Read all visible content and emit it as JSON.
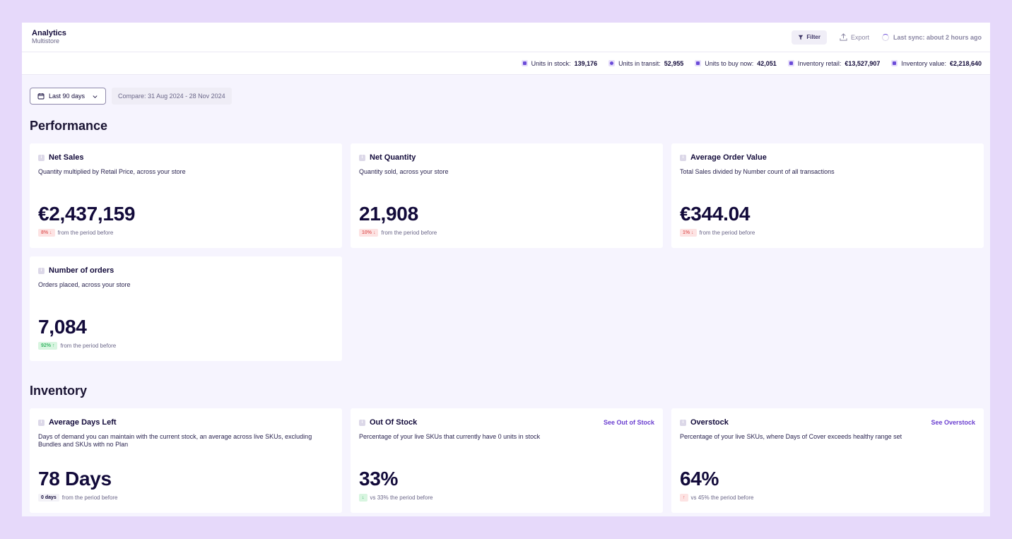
{
  "header": {
    "title": "Analytics",
    "subtitle": "Multistore",
    "filter_label": "Filter",
    "export_label": "Export",
    "sync_label": "Last sync: about 2 hours ago"
  },
  "stats": [
    {
      "label": "Units in stock:",
      "value": "139,176"
    },
    {
      "label": "Units in transit:",
      "value": "52,955"
    },
    {
      "label": "Units to buy now:",
      "value": "42,051"
    },
    {
      "label": "Inventory retail:",
      "value": "€13,527,907"
    },
    {
      "label": "Inventory value:",
      "value": "€2,218,640"
    }
  ],
  "toolbar": {
    "date_range": "Last 90 days",
    "compare": "Compare: 31 Aug 2024 - 28 Nov 2024"
  },
  "performance": {
    "title": "Performance",
    "cards": [
      {
        "title": "Net Sales",
        "desc": "Quantity multiplied by Retail Price, across your store",
        "value": "€2,437,159",
        "badge": "8% ↓",
        "foot": "from the period before",
        "tone": "red"
      },
      {
        "title": "Net Quantity",
        "desc": "Quantity sold, across your store",
        "value": "21,908",
        "badge": "10% ↓",
        "foot": "from the period before",
        "tone": "red"
      },
      {
        "title": "Average Order Value",
        "desc": "Total Sales divided by Number count of all transactions",
        "value": "€344.04",
        "badge": "1% ↓",
        "foot": "from the period before",
        "tone": "red"
      },
      {
        "title": "Number of orders",
        "desc": "Orders placed, across your store",
        "value": "7,084",
        "badge": "92% ↑",
        "foot": "from the period before",
        "tone": "green"
      }
    ]
  },
  "inventory": {
    "title": "Inventory",
    "cards": [
      {
        "title": "Average Days Left",
        "desc": "Days of demand you can maintain with the current stock, an average across live SKUs, excluding Bundles and SKUs with no Plan",
        "value": "78 Days",
        "badge": "0 days",
        "foot": "from the period before",
        "link": ""
      },
      {
        "title": "Out Of Stock",
        "desc": "Percentage of your live SKUs that currently have 0 units in stock",
        "value": "33%",
        "badge": "↓",
        "foot": "vs 33% the period before",
        "link": "See Out of Stock"
      },
      {
        "title": "Overstock",
        "desc": "Percentage of your live SKUs, where Days of Cover exceeds healthy range set",
        "value": "64%",
        "badge": "↑",
        "foot": "vs 45% the period before",
        "link": "See Overstock"
      }
    ]
  }
}
